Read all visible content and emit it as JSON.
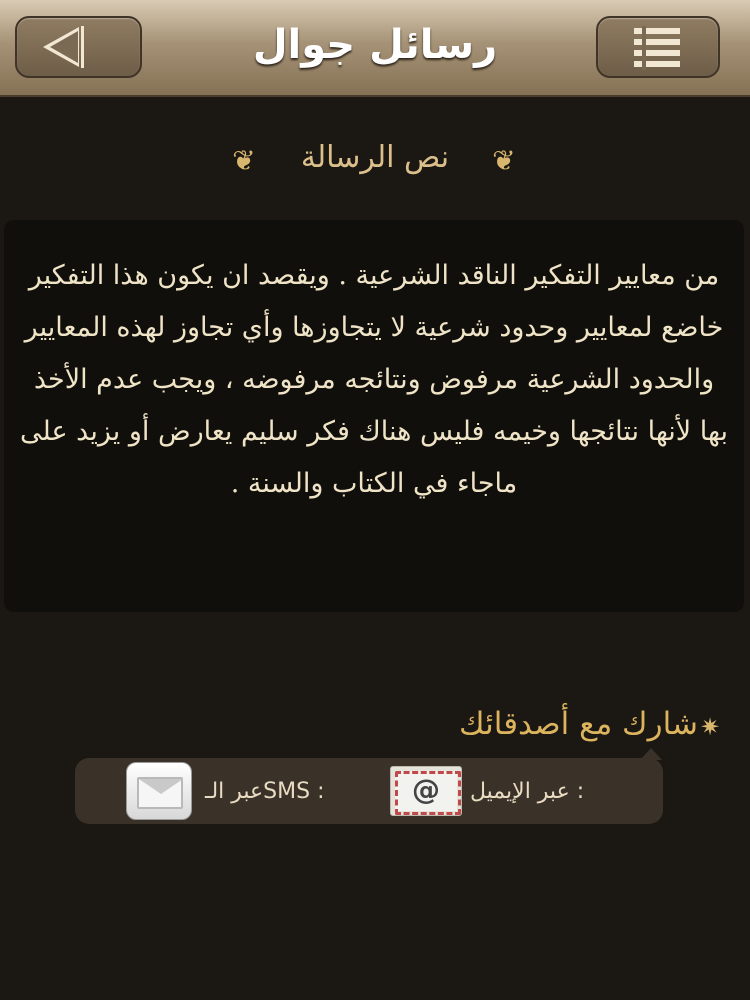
{
  "header": {
    "title": "رسائل جوال",
    "back_icon": "back-arrow-icon",
    "menu_icon": "list-menu-icon"
  },
  "message": {
    "heading": "نص الرسالة",
    "text": "من معايير التفكير الناقد الشرعية . ويقصد ان يكون هذا التفكير خاضع لمعايير وحدود شرعية لا يتجاوزها وأي تجاوز لهذه المعايير والحدود الشرعية مرفوض ونتائجه مرفوضه ، ويجب عدم الأخذ بها لأنها نتائجها وخيمه فليس هناك فكر سليم يعارض أو يزيد على ماجاء في الكتاب والسنة ."
  },
  "share": {
    "heading": "شارك مع أصدقائك",
    "email_label": "عبر الإيميل :",
    "email_icon_text": "@",
    "sms_label": "عبر الـSMS :"
  },
  "colors": {
    "background": "#1b1713",
    "accent_gold": "#dcb45e",
    "text_light": "#f0e4c7"
  }
}
